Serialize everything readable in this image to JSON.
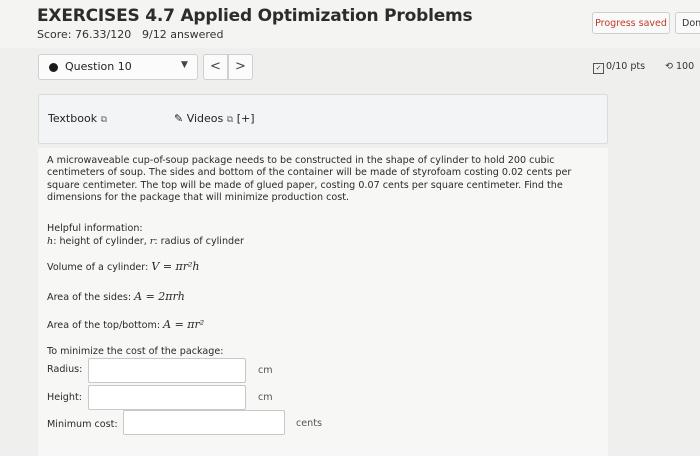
{
  "header": {
    "title": "EXERCISES 4.7 Applied Optimization Problems",
    "score": "Score: 76.33/120",
    "answered": "9/12 answered",
    "progress_label": "Progress saved",
    "done_label": "Done"
  },
  "question_nav": {
    "selected": "Question 10",
    "prev_glyph": "<",
    "next_glyph": ">",
    "points": "0/10 pts",
    "retry_label": "100"
  },
  "resources": {
    "textbook": "Textbook",
    "videos": "Videos",
    "videos_toggle": "[+]"
  },
  "problem": {
    "text": "A microwaveable cup-of-soup package needs to be constructed in the shape of cylinder to hold 200 cubic centimeters of soup. The sides and bottom of the container will be made of styrofoam costing 0.02 cents per square centimeter. The top will be made of glued paper, costing 0.07 cents per square centimeter. Find the dimensions for the package that will minimize production cost.",
    "helpful_title": "Helpful information:",
    "vars_h": "h",
    "vars_h_desc": ": height of cylinder, ",
    "vars_r": "r",
    "vars_r_desc": ": radius of cylinder",
    "volume_label": "Volume of a cylinder: ",
    "volume_formula": "V = πr²h",
    "sides_label": "Area of the sides: ",
    "sides_formula": "A = 2πrh",
    "top_label": "Area of the top/bottom: ",
    "top_formula": "A = πr²",
    "minimize_title": "To minimize the cost of the package:",
    "radius_label": "Radius:",
    "radius_unit": "cm",
    "height_label": "Height:",
    "height_unit": "cm",
    "cost_label": "Minimum cost:",
    "cost_unit": "cents",
    "radius_value": "",
    "height_value": "",
    "cost_value": ""
  },
  "colors": {
    "progress_text": "#c0392b",
    "panel_bg": "#f3f4f6"
  }
}
